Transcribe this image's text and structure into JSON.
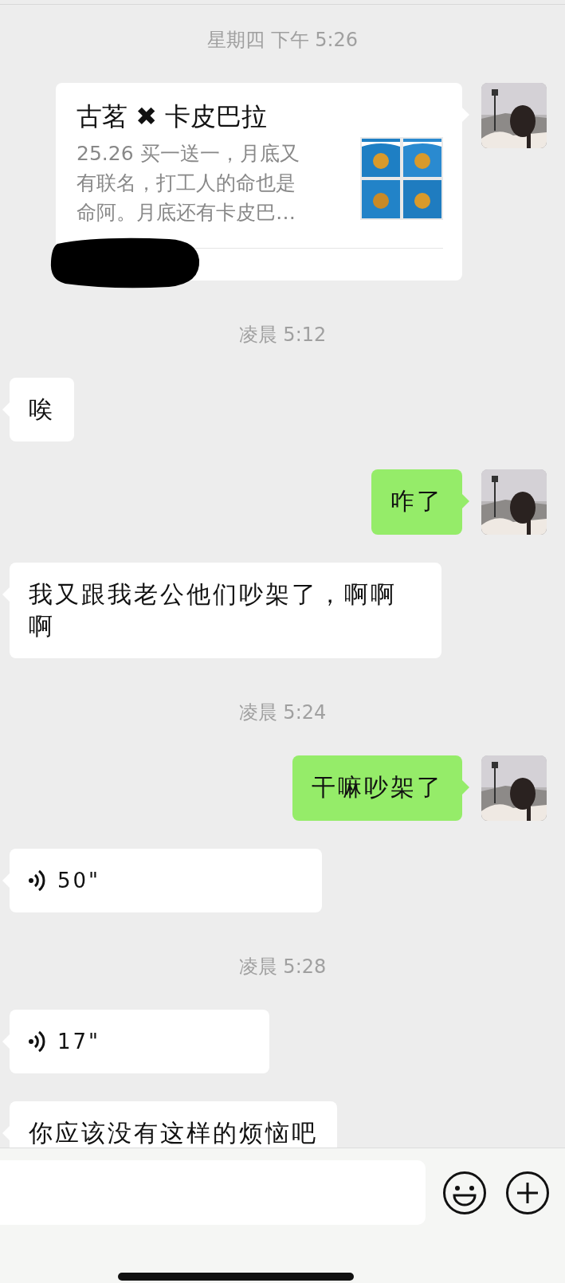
{
  "messages": [
    {
      "kind": "time",
      "text": "星期四 下午 5:26"
    },
    {
      "kind": "card",
      "outgoing": true,
      "title": "古茗 ✖ 卡皮巴拉",
      "description_lines": [
        "25.26 买一送一，月底又",
        "有联名，打工人的命也是",
        "命阿。月底还有卡皮巴…"
      ]
    },
    {
      "kind": "time",
      "text": "凌晨 5:12"
    },
    {
      "kind": "text",
      "outgoing": false,
      "text": "唉"
    },
    {
      "kind": "text",
      "outgoing": true,
      "text": "咋了"
    },
    {
      "kind": "text",
      "outgoing": false,
      "text": "我又跟我老公他们吵架了，啊啊啊"
    },
    {
      "kind": "time",
      "text": "凌晨 5:24"
    },
    {
      "kind": "text",
      "outgoing": true,
      "text": "干嘛吵架了"
    },
    {
      "kind": "voice",
      "outgoing": false,
      "duration": "50\""
    },
    {
      "kind": "time",
      "text": "凌晨 5:28"
    },
    {
      "kind": "voice",
      "outgoing": false,
      "duration": "17\""
    },
    {
      "kind": "text",
      "outgoing": false,
      "text": "你应该没有这样的烦恼吧"
    }
  ]
}
